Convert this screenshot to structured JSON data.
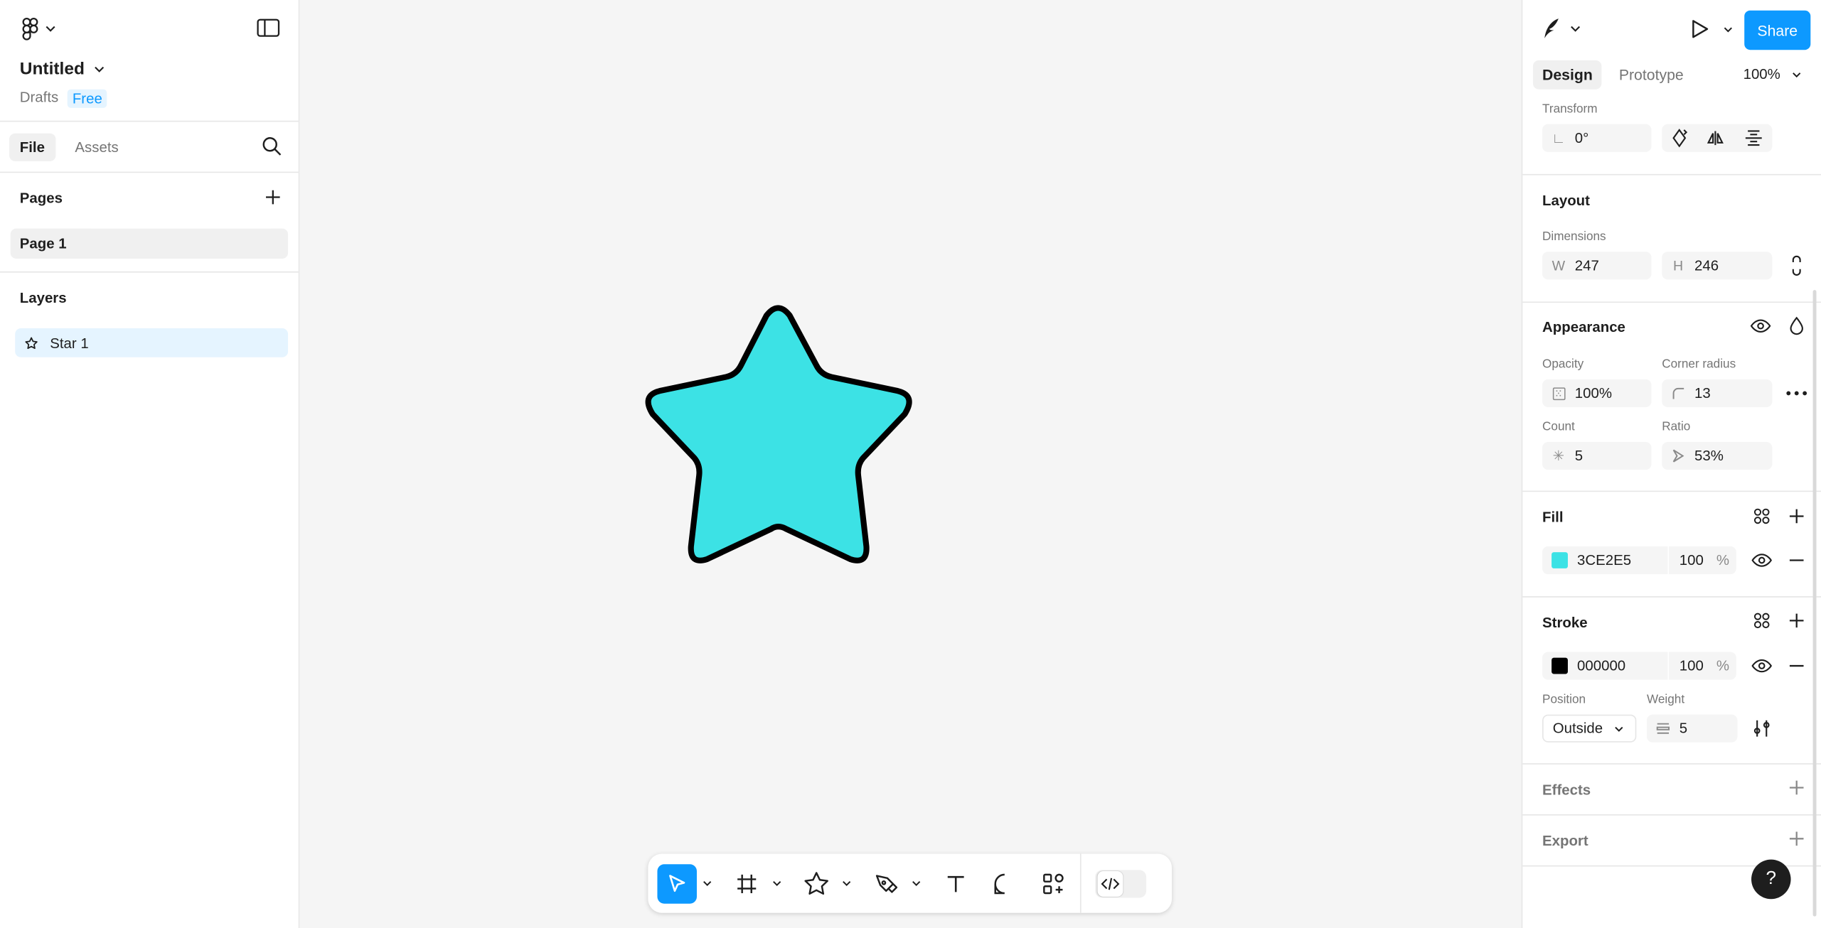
{
  "file": {
    "title": "Untitled",
    "location": "Drafts",
    "plan": "Free"
  },
  "left_tabs": {
    "file": "File",
    "assets": "Assets"
  },
  "pages": {
    "title": "Pages",
    "items": [
      {
        "label": "Page 1"
      }
    ]
  },
  "layers": {
    "title": "Layers",
    "items": [
      {
        "label": "Star 1",
        "icon": "star-icon"
      }
    ]
  },
  "header": {
    "share": "Share",
    "tab_design": "Design",
    "tab_prototype": "Prototype",
    "zoom": "100%"
  },
  "transform": {
    "title": "Transform",
    "rotation": "0°"
  },
  "layout": {
    "title": "Layout",
    "dimensions_label": "Dimensions",
    "w_prefix": "W",
    "w": "247",
    "h_prefix": "H",
    "h": "246"
  },
  "appearance": {
    "title": "Appearance",
    "opacity_label": "Opacity",
    "opacity": "100%",
    "corner_label": "Corner radius",
    "corner": "13",
    "count_label": "Count",
    "count": "5",
    "ratio_label": "Ratio",
    "ratio": "53%"
  },
  "fill": {
    "title": "Fill",
    "color_hex": "3CE2E5",
    "color": "#3CE2E5",
    "opacity": "100",
    "pct": "%"
  },
  "stroke": {
    "title": "Stroke",
    "color_hex": "000000",
    "color": "#000000",
    "opacity": "100",
    "pct": "%",
    "position_label": "Position",
    "position": "Outside",
    "weight_label": "Weight",
    "weight": "5"
  },
  "effects": {
    "title": "Effects"
  },
  "export": {
    "title": "Export"
  },
  "help": "?",
  "colors": {
    "accent": "#0D99FF",
    "star_fill": "#3CE2E5",
    "star_stroke": "#000000"
  }
}
